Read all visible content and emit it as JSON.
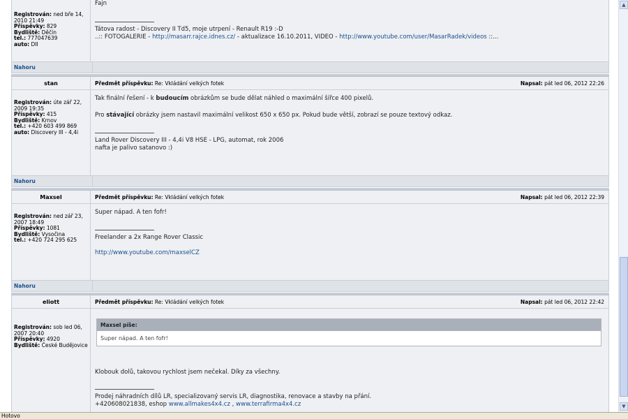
{
  "labels": {
    "registered": "Registrován:",
    "posts": "Příspěvky:",
    "location": "Bydliště:",
    "phone": "tel.:",
    "car": "auto:",
    "subject": "Předmět příspěvku:",
    "wrote": "Napsal:",
    "top": "Nahoru"
  },
  "post0": {
    "registered": "ned bře 14, 2010 21:49",
    "posts": "829",
    "location": "Děčín",
    "phone": "777047639",
    "car": "DII",
    "text": "Fajn",
    "sig1": "Tátova radost - Discovery II Td5, moje utrpení - Renault R19 :-D",
    "sig2a": "..:: FOTOGALERIE - ",
    "sig2link1": "http://masarr.rajce.idnes.cz/",
    "sig2b": " - aktualizace 16.10.2011, VIDEO - ",
    "sig2link2": "http://www.youtube.com/user/MasarRadek/videos",
    "sig2c": " ::..."
  },
  "post1": {
    "user": "stan",
    "subject": "Re: Vkládání velkých fotek",
    "date": "pát led 06, 2012 22:26",
    "registered": "úte zář 22, 2009 19:35",
    "posts": "415",
    "location": "Krnov",
    "phone": "+420 603 499 869",
    "car": "Discovery III - 4,4i",
    "p1a": "Tak finální řešení - k ",
    "p1b": "budoucím",
    "p1c": " obrázkům se bude dělat náhled o maximální šířce 400 pixelů.",
    "p2a": "Pro ",
    "p2b": "stávající",
    "p2c": " obrázky jsem nastavil maximální velikost 650 x 650 px. Pokud bude větší, zobrazí se pouze textový odkaz.",
    "sig1": "Land Rover Discovery III - 4,4i V8 HSE - LPG, automat, rok 2006",
    "sig2": "nafta je palivo satanovo :)"
  },
  "post2": {
    "user": "Maxsel",
    "subject": "Re: Vkládání velkých fotek",
    "date": "pát led 06, 2012 22:39",
    "registered": "ned zář 23, 2007 18:49",
    "posts": "1081",
    "location": "Vysočina",
    "phone": "+420 724 295 625",
    "text": "Super nápad. A ten fofr!",
    "sig1": "Freelander a 2x Range Rover Classic",
    "sig2": "http://www.youtube.com/maxselCZ"
  },
  "post3": {
    "user": "eliott",
    "subject": "Re: Vkládání velkých fotek",
    "date": "pát led 06, 2012 22:42",
    "registered": "sob led 06, 2007 20:40",
    "posts": "4920",
    "location": "České Budějovice",
    "quote_author": "Maxsel píše:",
    "quote_text": "Super nápad. A ten fofr!",
    "text": "Klobouk dolů, takovou rychlost jsem nečekal. Díky za všechny.",
    "sig1": "Prodej náhradních dílů LR, specializovaný servis LR, diagnostika, renovace a stavby na přání.",
    "sig2a": "+420608021838, eshop ",
    "sig2link1": "www.allmakes4x4.cz",
    "sig2b": " , ",
    "sig2link2": "www.terrafirma4x4.cz"
  },
  "status": "Hotovo"
}
